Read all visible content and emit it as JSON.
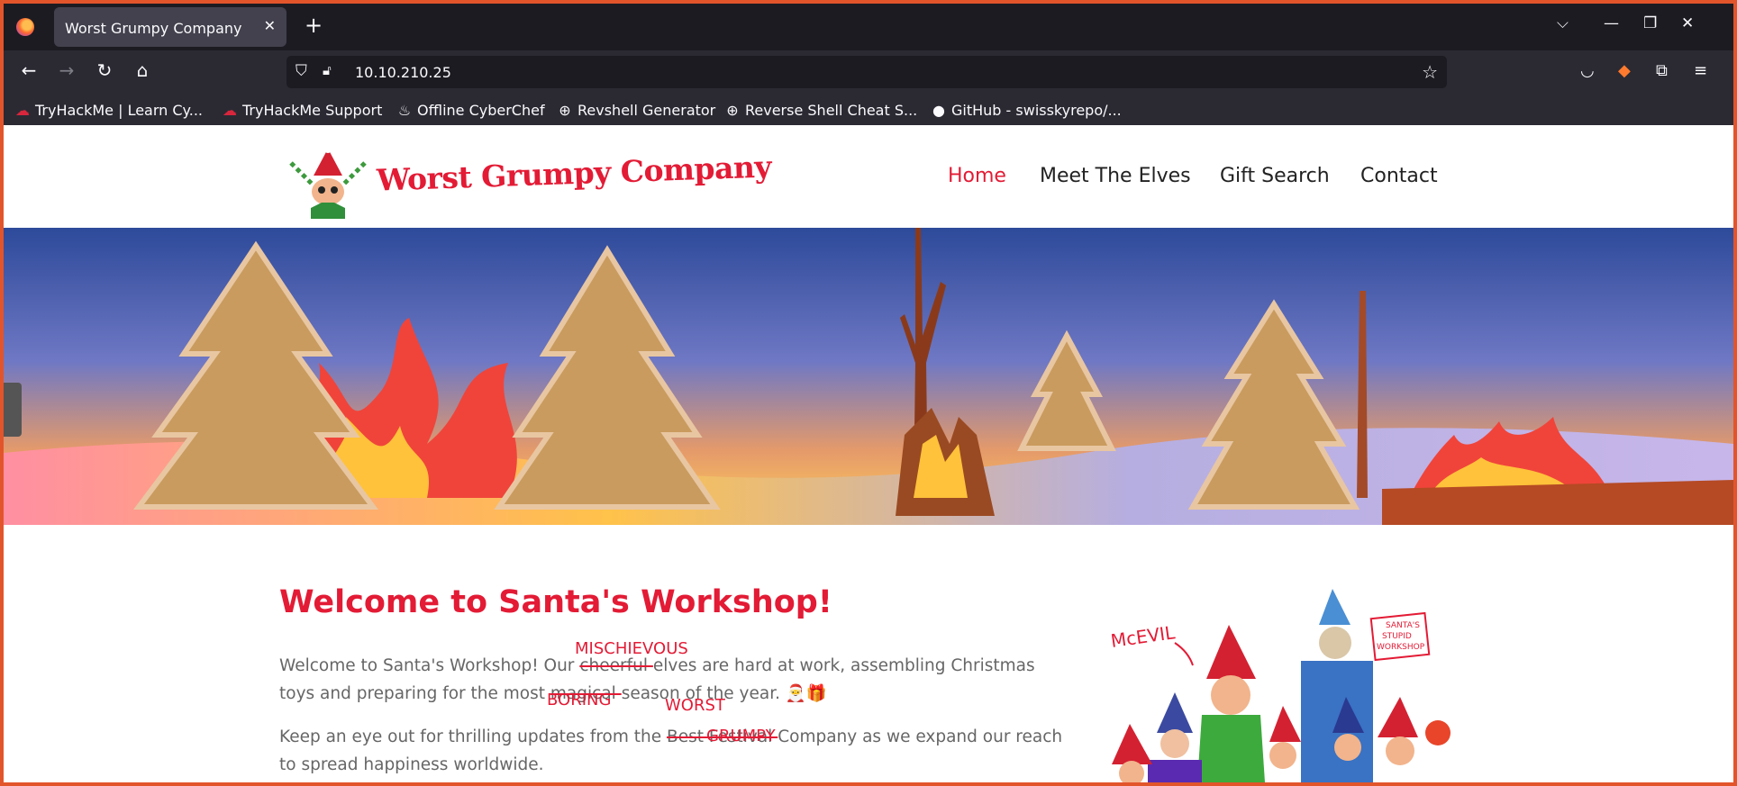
{
  "browser": {
    "tab_title": "Worst Grumpy Company",
    "url": "10.10.210.25",
    "bookmarks": [
      {
        "label": "TryHackMe | Learn Cy...",
        "icon": "tryhackme-icon"
      },
      {
        "label": "TryHackMe Support",
        "icon": "tryhackme-icon"
      },
      {
        "label": "Offline CyberChef",
        "icon": "chef-icon"
      },
      {
        "label": "Revshell Generator",
        "icon": "globe-icon"
      },
      {
        "label": "Reverse Shell Cheat S...",
        "icon": "globe-icon"
      },
      {
        "label": "GitHub - swisskyrepo/...",
        "icon": "github-icon"
      }
    ]
  },
  "site": {
    "logo_text": "Worst Grumpy Company",
    "nav": [
      {
        "label": "Home",
        "active": true
      },
      {
        "label": "Meet The Elves",
        "active": false
      },
      {
        "label": "Gift Search",
        "active": false
      },
      {
        "label": "Contact",
        "active": false
      }
    ]
  },
  "content": {
    "title": "Welcome to Santa's Workshop!",
    "p1": {
      "before": "Welcome to Santa's Workshop! Our ",
      "strike1": "cheerful ",
      "mid": "elves are hard at work, assembling Christmas toys and preparing for the most ",
      "strike2": "magical ",
      "after": "season of the year. 🎅🎁"
    },
    "p2": {
      "before": "Keep an eye out for thrilling updates from the ",
      "strike": "Best Festival ",
      "after": "Company as we expand our reach to spread happiness worldwide."
    },
    "annotations": {
      "mischievous": "MISCHIEVOUS",
      "boring": "BORING",
      "worst": "WORST",
      "grumpy": "GRUMPY"
    },
    "sketch_labels": {
      "mcevil": "McEVIL",
      "workshop_l1": "SANTA'S",
      "workshop_l2": "STUPID",
      "workshop_l3": "WORKSHOP"
    }
  },
  "colors": {
    "accent_red": "#e31b35",
    "chrome_dark": "#1c1b22",
    "chrome_bar": "#2b2a33",
    "body_text": "#666666"
  }
}
